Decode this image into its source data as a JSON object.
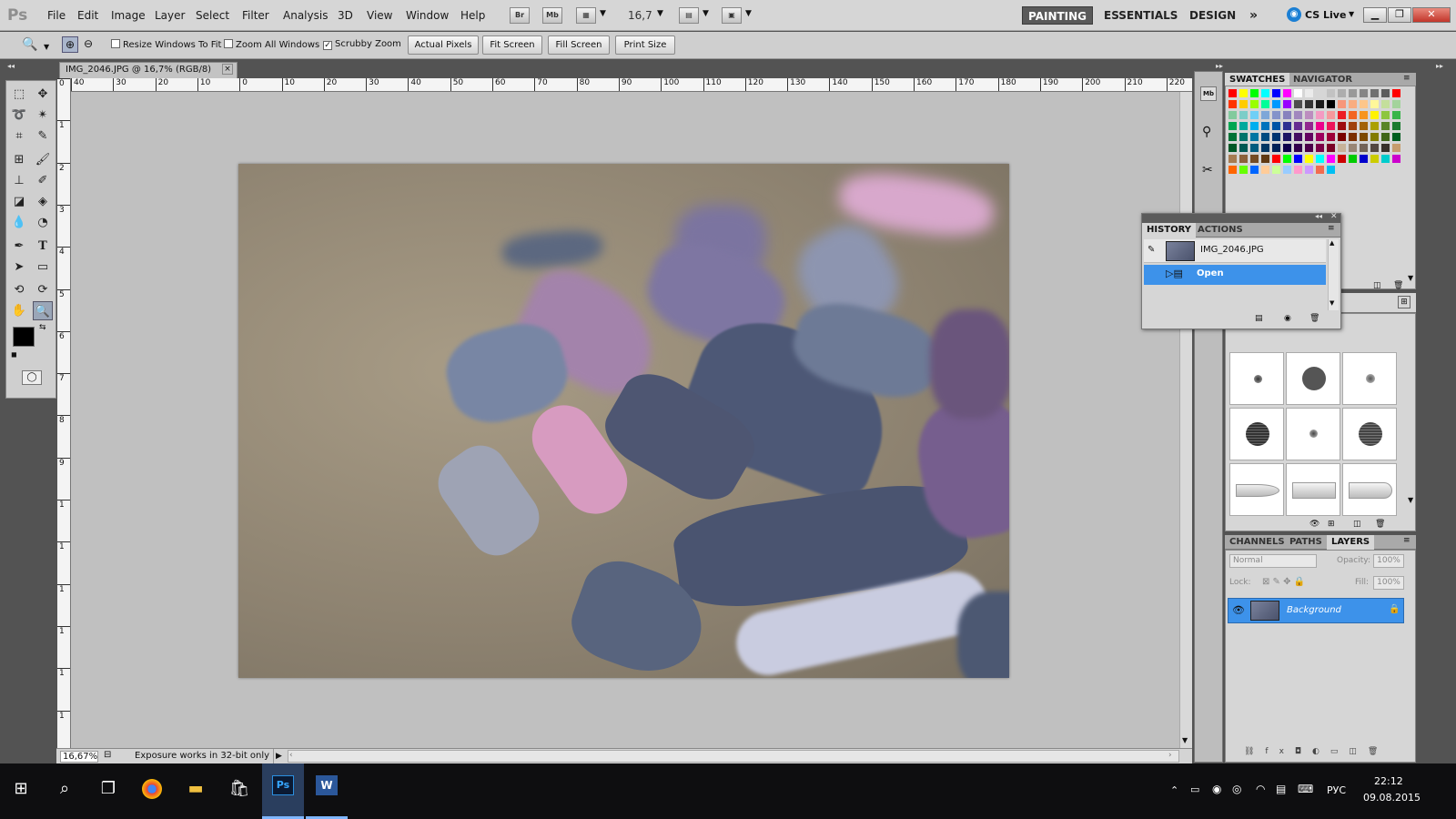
{
  "app": {
    "logo": "Ps"
  },
  "menu": [
    "File",
    "Edit",
    "Image",
    "Layer",
    "Select",
    "Filter",
    "Analysis",
    "3D",
    "View",
    "Window",
    "Help"
  ],
  "menubar": {
    "bridge_label": "Br",
    "minibridge_label": "Mb",
    "zoom_value": "16,7",
    "workspaces": [
      "PAINTING",
      "ESSENTIALS",
      "DESIGN"
    ],
    "more": "»",
    "cslive": "CS Live"
  },
  "options": {
    "resize_windows": "Resize Windows To Fit",
    "zoom_all": "Zoom All Windows",
    "scrubby": "Scrubby Zoom",
    "scrubby_checked": true,
    "actual_pixels": "Actual Pixels",
    "fit_screen": "Fit Screen",
    "fill_screen": "Fill Screen",
    "print_size": "Print Size"
  },
  "document": {
    "tab_title": "IMG_2046.JPG @ 16,7% (RGB/8)",
    "close": "×",
    "ruler_top": [
      "40",
      "30",
      "20",
      "10",
      "0",
      "10",
      "20",
      "30",
      "40",
      "50",
      "60",
      "70",
      "80",
      "90",
      "100",
      "110",
      "120",
      "130",
      "140",
      "150",
      "160",
      "170",
      "180",
      "190",
      "200",
      "210",
      "220"
    ],
    "ruler_left": [
      "0",
      "1",
      "2",
      "3",
      "4",
      "5",
      "6",
      "7",
      "8",
      "9",
      "1",
      "1",
      "1",
      "1",
      "1",
      "1"
    ]
  },
  "status": {
    "zoom": "16,67%",
    "message": "Exposure works in 32-bit only"
  },
  "panels": {
    "swatches_tab": "SWATCHES",
    "navigator_tab": "NAVIGATOR",
    "history_tab": "HISTORY",
    "actions_tab": "ACTIONS",
    "history_items": [
      {
        "label": "IMG_2046.JPG",
        "selected": false
      },
      {
        "label": "Open",
        "selected": true
      }
    ],
    "channels_tab": "CHANNELS",
    "paths_tab": "PATHS",
    "layers_tab": "LAYERS",
    "blend_mode": "Normal",
    "opacity_label": "Opacity:",
    "opacity_value": "100%",
    "lock_label": "Lock:",
    "fill_label": "Fill:",
    "fill_value": "100%",
    "layer_name": "Background"
  },
  "swatch_colors": [
    "#ff0000",
    "#ffff00",
    "#00ff00",
    "#00ffff",
    "#0000ff",
    "#ff00ff",
    "#ffffff",
    "#ebebeb",
    "#d6d6d6",
    "#c2c2c2",
    "#adadad",
    "#999999",
    "#858585",
    "#707070",
    "#5c5c5c",
    "#ff0000",
    "#ff3300",
    "#ffcc00",
    "#99ff00",
    "#00ff99",
    "#0099ff",
    "#9900ff",
    "#4d4d4d",
    "#333333",
    "#1a1a1a",
    "#000000",
    "#f7977a",
    "#f9ad81",
    "#fdc68a",
    "#fff79a",
    "#c4df9b",
    "#a3d39c",
    "#82ca9d",
    "#7bcdc8",
    "#6ecff6",
    "#7ea7d8",
    "#8493ca",
    "#8882be",
    "#a187be",
    "#bc8dbf",
    "#f49ac2",
    "#f6989d",
    "#ed1c24",
    "#f26522",
    "#f7941d",
    "#fff200",
    "#8dc63f",
    "#39b54a",
    "#00a651",
    "#00a99d",
    "#00aeef",
    "#0072bc",
    "#0054a6",
    "#2e3192",
    "#662d91",
    "#92278f",
    "#ec008c",
    "#ed145b",
    "#9e0b0f",
    "#a0410d",
    "#a36209",
    "#aba000",
    "#598527",
    "#1a7b30",
    "#007236",
    "#00746b",
    "#0076a3",
    "#004b80",
    "#003471",
    "#1b1464",
    "#440e62",
    "#630460",
    "#9e005d",
    "#9e0039",
    "#790000",
    "#7b2e00",
    "#7d4900",
    "#827b00",
    "#406618",
    "#005e20",
    "#005826",
    "#005952",
    "#005b7f",
    "#003663",
    "#002157",
    "#0d004c",
    "#32004b",
    "#4b0049",
    "#7b0046",
    "#7a0026",
    "#c7b299",
    "#998675",
    "#736357",
    "#534741",
    "#37302a",
    "#c69c6d",
    "#a67c52",
    "#8c6239",
    "#754c24",
    "#603913",
    "#ff0000",
    "#00ff00",
    "#0000ff",
    "#ffff00",
    "#00ffff",
    "#ff00ff",
    "#cc0000",
    "#00cc00",
    "#0000cc",
    "#cccc00",
    "#00cccc",
    "#cc00cc",
    "#ff6600",
    "#66ff00",
    "#0066ff",
    "#ffcc99",
    "#ccff99",
    "#99ccff",
    "#ff99cc",
    "#cc99ff",
    "#f26c4f",
    "#00bff3"
  ],
  "taskbar": {
    "lang": "РУС",
    "time": "22:12",
    "date": "09.08.2015"
  }
}
